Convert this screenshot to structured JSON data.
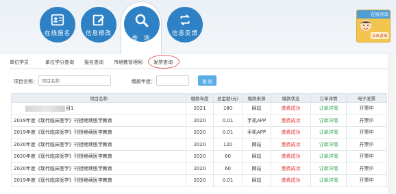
{
  "nav": {
    "items": [
      {
        "label": "在线报名",
        "icon": "id-card-icon"
      },
      {
        "label": "信息修改",
        "icon": "edit-icon"
      },
      {
        "label": "查 询",
        "icon": "search-icon",
        "active": true
      },
      {
        "label": "信息反馈",
        "icon": "refresh-icon"
      }
    ],
    "service": {
      "top": "在线咨询",
      "bottom": "点击咨询"
    }
  },
  "tabs": [
    "单位学员",
    "单位学分查询",
    "报名查询",
    "市继教管理网",
    "发票查询"
  ],
  "filters": {
    "project_label": "项目名称：",
    "project_placeholder": "项目名称",
    "year_label": "缴款年度：",
    "year_value": "",
    "search_label": "查 询"
  },
  "table": {
    "headers": [
      "项目名称",
      "缴款年度",
      "总金额(元)",
      "缴款来源",
      "缴款状态",
      "订单详情",
      "电子发票"
    ],
    "rows": [
      {
        "name": "目1",
        "year": "2021",
        "amount": "180",
        "source": "网站",
        "status": "缴费成功",
        "detail": "订单详情",
        "invoice": "开票中"
      },
      {
        "name": "2019年度《现代临床医学》刊授继续医学教育",
        "year": "2020",
        "amount": "0.01",
        "source": "手机APP",
        "status": "缴费成功",
        "detail": "订单详情",
        "invoice": "开票中"
      },
      {
        "name": "2019年度《现代临床医学》刊授继续医学教育",
        "year": "2020",
        "amount": "0.01",
        "source": "手机APP",
        "status": "缴费成功",
        "detail": "订单详情",
        "invoice": "开票中"
      },
      {
        "name": "2020年度《现代临床医学》刊授继续医学教育",
        "year": "2020",
        "amount": "120",
        "source": "网站",
        "status": "缴费成功",
        "detail": "订单详情",
        "invoice": "开票中"
      },
      {
        "name": "2020年度《现代临床医学》刊授继续医学教育",
        "year": "2020",
        "amount": "60",
        "source": "网站",
        "status": "缴费成功",
        "detail": "订单详情",
        "invoice": "开票中"
      },
      {
        "name": "2020年度《现代临床医学》刊授继续医学教育",
        "year": "2020",
        "amount": "60",
        "source": "网站",
        "status": "缴费成功",
        "detail": "订单详情",
        "invoice": "开票中"
      },
      {
        "name": "2019年度《现代临床医学》刊授继续医学教育",
        "year": "2020",
        "amount": "0.01",
        "source": "网站",
        "status": "缴费成功",
        "detail": "订单详情",
        "invoice": "开票中"
      }
    ]
  },
  "colors": {
    "accent": "#2e81c4",
    "paid": "#e23a3a",
    "detail": "#2fa84f"
  }
}
